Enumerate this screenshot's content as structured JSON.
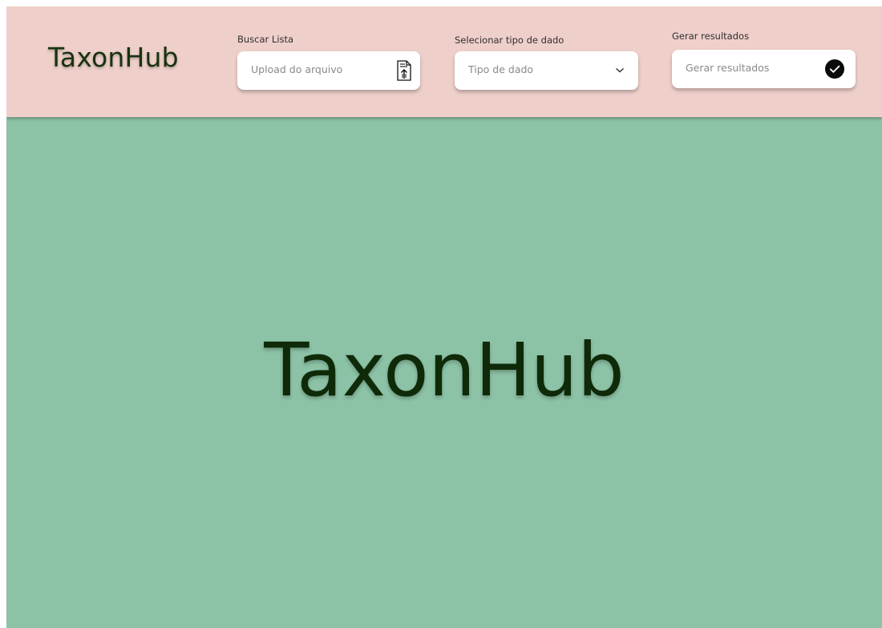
{
  "header": {
    "logo": "TaxonHub",
    "upload": {
      "label": "Buscar Lista",
      "placeholder": "Upload do arquivo",
      "icon": "upload-file-icon"
    },
    "data_type": {
      "label": "Selecionar tipo de dado",
      "selected": "Tipo de dado",
      "icon": "chevron-down-icon"
    },
    "generate": {
      "label": "Gerar resultados",
      "button_text": "Gerar resultados",
      "icon": "check-circle-icon"
    }
  },
  "main": {
    "hero_title": "TaxonHub"
  },
  "colors": {
    "header_bg": "#efcfca",
    "main_bg": "#8cc2a6",
    "text_dark_green": "#17330f",
    "control_bg": "#ffffff"
  }
}
